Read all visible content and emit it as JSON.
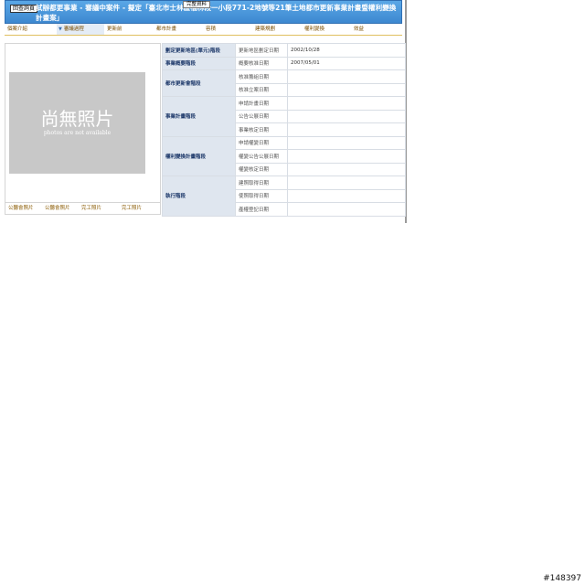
{
  "header": {
    "back_label": "回查詢頁",
    "note_label": "完整資料",
    "title": "試辦都更事業 - 審議中案件 - 擬定「臺北市士林區福林段一小段771-2地號等21筆土地都市更新事業計畫暨權利變換計畫案」"
  },
  "tabs": [
    {
      "label": "個案介紹",
      "active": false
    },
    {
      "label": "審議過程",
      "active": true
    },
    {
      "label": "更新前",
      "active": false
    },
    {
      "label": "都市計畫",
      "active": false
    },
    {
      "label": "容積",
      "active": false
    },
    {
      "label": "建築規劃",
      "active": false
    },
    {
      "label": "權利變換",
      "active": false
    },
    {
      "label": "效益",
      "active": false
    }
  ],
  "photo": {
    "placeholder_cn": "尚無照片",
    "placeholder_en": "photos are not available"
  },
  "photo_tabs": [
    "公聽會照片",
    "公聽會照片",
    "完工照片",
    "完工照片"
  ],
  "stages": [
    {
      "name": "劃定更新地區(單元)階段",
      "rows": [
        {
          "label": "更新地區劃定日期",
          "value": "2002/10/28"
        }
      ]
    },
    {
      "name": "事業概要階段",
      "rows": [
        {
          "label": "概要核准日期",
          "value": "2007/05/01"
        }
      ]
    },
    {
      "name": "都市更新會階段",
      "rows": [
        {
          "label": "核准籌組日期",
          "value": ""
        },
        {
          "label": "核准立案日期",
          "value": ""
        }
      ]
    },
    {
      "name": "事業計畫階段",
      "rows": [
        {
          "label": "申請計畫日期",
          "value": ""
        },
        {
          "label": "公告公展日期",
          "value": ""
        },
        {
          "label": "事業核定日期",
          "value": ""
        }
      ]
    },
    {
      "name": "權利變換計畫階段",
      "rows": [
        {
          "label": "申請權變日期",
          "value": ""
        },
        {
          "label": "權變公告公展日期",
          "value": ""
        },
        {
          "label": "權變核定日期",
          "value": ""
        }
      ]
    },
    {
      "name": "執行階段",
      "rows": [
        {
          "label": "建照取得日期",
          "value": ""
        },
        {
          "label": "使照取得日期",
          "value": ""
        },
        {
          "label": "產權登記日期",
          "value": ""
        }
      ]
    }
  ],
  "footer": {
    "id": "#148397"
  }
}
